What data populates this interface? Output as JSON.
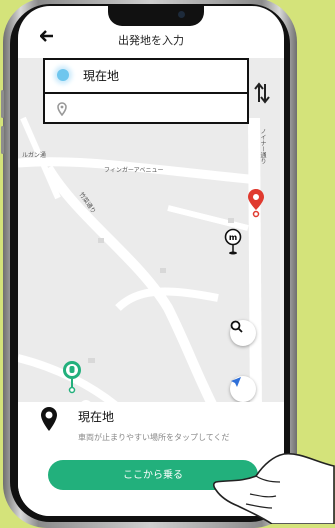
{
  "header": {
    "back_icon": "arrow-left-icon",
    "title": "出発地を入力"
  },
  "address": {
    "origin_label": "現在地",
    "destination_value": "",
    "swap_icon": "swap-vertical-icon"
  },
  "map": {
    "labels": {
      "street_left": "ルガン通",
      "avenue": "フィンガーアベニュー",
      "street_vert": "ノイナー通り",
      "street_diag": "竹菜通り"
    },
    "markers": [
      "red-pin-icon",
      "metro-pin-icon",
      "green-hand-pin-icon",
      "current-location-icon"
    ],
    "search_icon": "search-icon",
    "locate_icon": "navigation-arrow-icon"
  },
  "panel": {
    "place_name": "現在地",
    "hint": "車両が止まりやすい場所をタップしてくだ",
    "ride_button": "ここから乗る"
  },
  "colors": {
    "background": "#d4e37a",
    "accent": "#22b07c",
    "pin_red": "#e03a2f",
    "location_blue": "#2f8df0"
  }
}
